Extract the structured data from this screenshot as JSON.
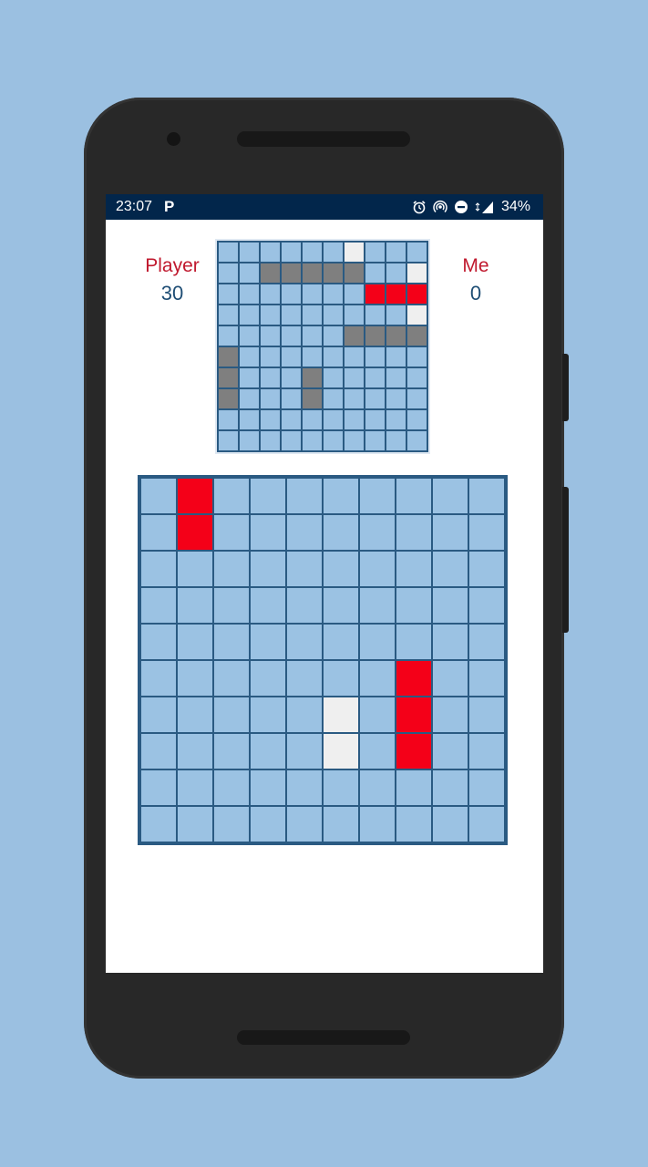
{
  "status_bar": {
    "time": "23:07",
    "notification_icon": "P",
    "battery": "34%",
    "icons": [
      "alarm-icon",
      "hotspot-icon",
      "dnd-icon",
      "signal-icon"
    ]
  },
  "scores": {
    "player_label": "Player",
    "player_score": "30",
    "me_label": "Me",
    "me_score": "0"
  },
  "colors": {
    "water": "#9BC2E3",
    "ship": "#7F7F7F",
    "hit": "#F40018",
    "miss": "#EFEFEF",
    "grid_line": "#2A5A82",
    "label": "#C0192E",
    "value": "#1F4E75"
  },
  "own_board": {
    "size": 10,
    "cells": [
      [
        0,
        6,
        "miss"
      ],
      [
        1,
        2,
        "ship"
      ],
      [
        1,
        3,
        "ship"
      ],
      [
        1,
        4,
        "ship"
      ],
      [
        1,
        5,
        "ship"
      ],
      [
        1,
        6,
        "ship"
      ],
      [
        1,
        9,
        "miss"
      ],
      [
        2,
        7,
        "hit"
      ],
      [
        2,
        8,
        "hit"
      ],
      [
        2,
        9,
        "hit"
      ],
      [
        3,
        9,
        "miss"
      ],
      [
        4,
        6,
        "ship"
      ],
      [
        4,
        7,
        "ship"
      ],
      [
        4,
        8,
        "ship"
      ],
      [
        4,
        9,
        "ship"
      ],
      [
        5,
        0,
        "ship"
      ],
      [
        6,
        0,
        "ship"
      ],
      [
        6,
        4,
        "ship"
      ],
      [
        7,
        0,
        "ship"
      ],
      [
        7,
        4,
        "ship"
      ]
    ]
  },
  "target_board": {
    "size": 10,
    "cells": [
      [
        0,
        1,
        "hit"
      ],
      [
        1,
        1,
        "hit"
      ],
      [
        5,
        7,
        "hit"
      ],
      [
        6,
        7,
        "hit"
      ],
      [
        7,
        7,
        "hit"
      ],
      [
        6,
        5,
        "miss"
      ],
      [
        7,
        5,
        "miss"
      ]
    ]
  }
}
